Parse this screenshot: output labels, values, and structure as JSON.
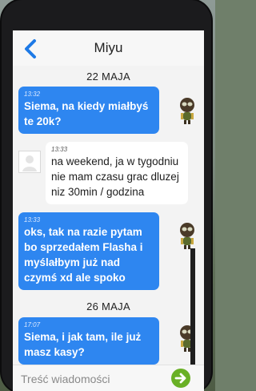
{
  "header": {
    "title": "Miyu"
  },
  "dates": [
    "22 MAJA",
    "26 MAJA"
  ],
  "messages": [
    {
      "direction": "out",
      "time": "13:32",
      "text": "Siema, na kiedy miałbyś te 20k?"
    },
    {
      "direction": "in",
      "time": "13:33",
      "text": "na weekend, ja w tygodniu nie mam czasu grac dluzej niz 30min / godzina"
    },
    {
      "direction": "out",
      "time": "13:33",
      "text": "oks, tak na razie pytam bo sprzedałem Flasha i myślałbym już nad czymś xd ale spoko"
    },
    {
      "direction": "out",
      "time": "17:07",
      "text": "Siema, i jak tam, ile już masz kasy?"
    }
  ],
  "composer": {
    "placeholder": "Treść wiadomości"
  },
  "colors": {
    "outgoing": "#2e86f0",
    "incoming": "#ffffff",
    "send": "#69b025",
    "accent": "#1e7ae6"
  },
  "icons": {
    "back": "chevron-left-icon",
    "send": "arrow-right-icon",
    "contact_avatar": "default-avatar-icon",
    "own_avatar": "character-avatar-icon"
  }
}
